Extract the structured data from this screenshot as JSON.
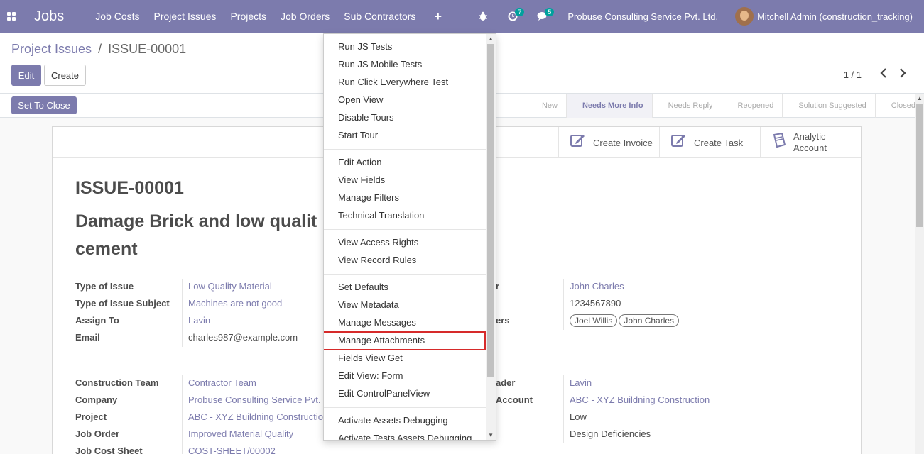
{
  "navbar": {
    "brand": "Jobs",
    "menu": [
      "Job Costs",
      "Project Issues",
      "Projects",
      "Job Orders",
      "Sub Contractors"
    ],
    "activity_count": "7",
    "messages_count": "5",
    "company": "Probuse Consulting Service Pvt. Ltd.",
    "user": "Mitchell Admin (construction_tracking)"
  },
  "breadcrumb": {
    "parent": "Project Issues",
    "separator": "/",
    "current": "ISSUE-00001"
  },
  "buttons": {
    "edit": "Edit",
    "create": "Create",
    "set_to_close": "Set To Close"
  },
  "pager": {
    "value": "1 / 1"
  },
  "stages": [
    "New",
    "Needs More Info",
    "Needs Reply",
    "Reopened",
    "Solution Suggested",
    "Closed"
  ],
  "active_stage": "Needs More Info",
  "smart_buttons": {
    "invoice": "Create Invoice",
    "task": "Create Task",
    "account_line1": "Analytic",
    "account_line2": "Account"
  },
  "record": {
    "code": "ISSUE-00001",
    "name": "Damage Brick and low quality cement",
    "name_line1": "Damage Brick and low qualit",
    "name_line2": "cement"
  },
  "left_fields": [
    {
      "label": "Type of Issue",
      "value": "Low Quality Material"
    },
    {
      "label": "Type of Issue Subject",
      "value": "Machines are not good"
    },
    {
      "label": "Assign To",
      "value": "Lavin"
    },
    {
      "label": "Email",
      "value": "charles987@example.com"
    }
  ],
  "left_fields2": [
    {
      "label": "Construction Team",
      "value": "Contractor Team"
    },
    {
      "label": "Company",
      "value": "Probuse Consulting Service Pvt."
    },
    {
      "label": "Project",
      "value": "ABC - XYZ Buildning Constructio"
    },
    {
      "label": "Job Order",
      "value": "Improved Material Quality"
    },
    {
      "label": "Job Cost Sheet",
      "value": "COST-SHEET/00002"
    }
  ],
  "right_fields": [
    {
      "label": "r",
      "value": "John Charles"
    },
    {
      "label": "",
      "value": "1234567890"
    },
    {
      "label": "ers",
      "tags": [
        "Joel Willis",
        "John Charles"
      ]
    }
  ],
  "right_fields2": [
    {
      "label": "ader",
      "value": "Lavin"
    },
    {
      "label": "Account",
      "value": "ABC - XYZ Buildning Construction"
    },
    {
      "label": "",
      "value": "Low"
    },
    {
      "label": "",
      "value": "Design Deficiencies"
    }
  ],
  "debug_menu": {
    "group1": [
      "Run JS Tests",
      "Run JS Mobile Tests",
      "Run Click Everywhere Test",
      "Open View",
      "Disable Tours",
      "Start Tour"
    ],
    "group2": [
      "Edit Action",
      "View Fields",
      "Manage Filters",
      "Technical Translation"
    ],
    "group3": [
      "View Access Rights",
      "View Record Rules"
    ],
    "group4": [
      "Set Defaults",
      "View Metadata",
      "Manage Messages",
      "Manage Attachments",
      "Fields View Get",
      "Edit View: Form",
      "Edit ControlPanelView"
    ],
    "group5": [
      "Activate Assets Debugging",
      "Activate Tests Assets Debugging"
    ],
    "highlighted": "Manage Attachments"
  }
}
